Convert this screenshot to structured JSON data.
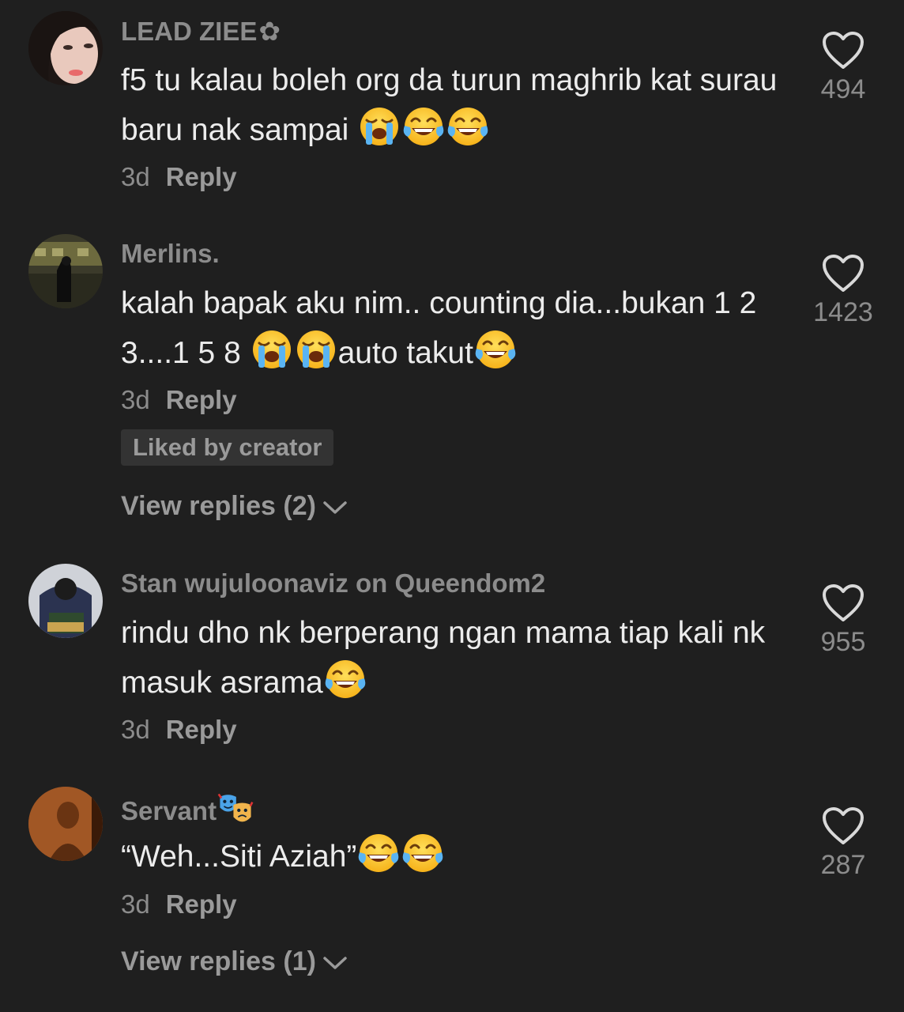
{
  "comments": [
    {
      "username": "LEAD ZIEE",
      "username_decoration": "✿",
      "text_parts": [
        "f5 tu kalau boleh org da turun maghrib kat surau baru nak sampai "
      ],
      "emojis": [
        "loudly-crying-face",
        "face-with-tears-of-joy",
        "face-with-tears-of-joy"
      ],
      "age": "3d",
      "reply_label": "Reply",
      "likes": "494"
    },
    {
      "username": "Merlins.",
      "text_parts": [
        "kalah bapak aku nim.. counting dia...bukan 1 2 3....1 5 8 ",
        "auto takut"
      ],
      "emojis": [
        "loudly-crying-face",
        "loudly-crying-face",
        "face-with-tears-of-joy"
      ],
      "age": "3d",
      "reply_label": "Reply",
      "likes": "1423",
      "badge": "Liked by creator",
      "view_replies": "View replies (2)"
    },
    {
      "username": "Stan wujuloonaviz on Queendom2",
      "text_parts": [
        "rindu dho nk berperang ngan mama tiap kali nk masuk asrama"
      ],
      "emojis": [
        "face-with-tears-of-joy"
      ],
      "age": "3d",
      "reply_label": "Reply",
      "likes": "955"
    },
    {
      "username": "Servant",
      "username_emoji": "performing-arts",
      "text_parts": [
        "“Weh...Siti Aziah”"
      ],
      "emojis": [
        "face-with-tears-of-joy",
        "face-with-tears-of-joy"
      ],
      "age": "3d",
      "reply_label": "Reply",
      "likes": "287",
      "view_replies": "View replies (1)"
    }
  ],
  "colors": {
    "background": "#1f1f1f",
    "primary_text": "#ececec",
    "secondary_text": "#8c8c8c",
    "badge_background": "#333333"
  }
}
